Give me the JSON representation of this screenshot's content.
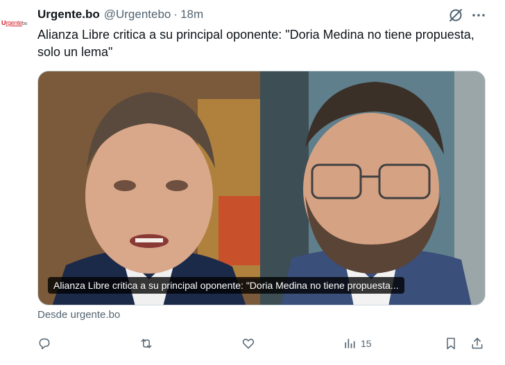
{
  "tweet": {
    "avatar": {
      "logo_text_u": "U",
      "logo_text_rest": "rgente",
      "logo_text_bo": "bo"
    },
    "author_name": "Urgente.bo",
    "author_handle": "@Urgentebo",
    "separator": "·",
    "time": "18m",
    "text": "Alianza Libre critica a su principal oponente: \"Doria Medina no tiene propuesta, solo un lema\"",
    "card": {
      "title": "Alianza Libre critica a su principal oponente: \"Doria Medina no tiene propuesta..."
    },
    "source": "Desde urgente.bo",
    "actions": {
      "reply_count": "",
      "retweet_count": "",
      "like_count": "",
      "views_count": "15"
    }
  },
  "icons": {
    "header": [
      "grok-icon",
      "more-icon"
    ],
    "actions": [
      "reply-icon",
      "retweet-icon",
      "like-icon",
      "views-icon",
      "bookmark-icon",
      "share-icon"
    ]
  },
  "colors": {
    "text": "#0f1419",
    "secondary": "#536471",
    "border": "#cfd9de",
    "brand_logo": "#d4202a"
  }
}
